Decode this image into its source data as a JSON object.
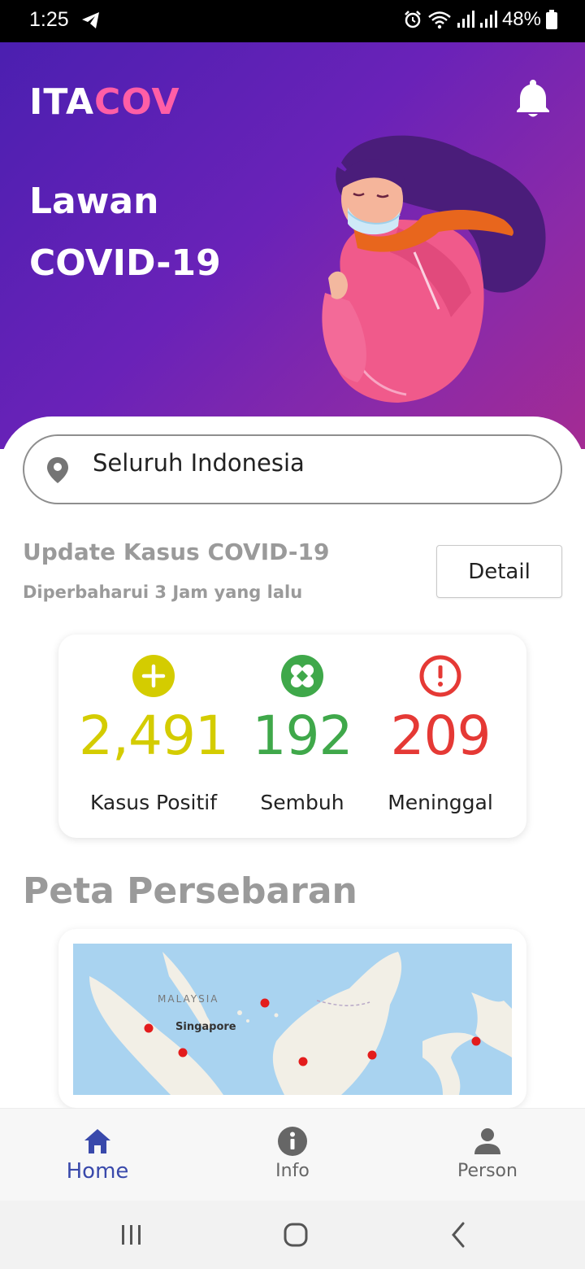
{
  "status_bar": {
    "time": "1:25",
    "battery": "48%"
  },
  "header": {
    "brand_part1": "ITA",
    "brand_part2": "COV",
    "title_line1": "Lawan",
    "title_line2": "COVID-19"
  },
  "location": {
    "label": "Seluruh Indonesia"
  },
  "update": {
    "title": "Update Kasus COVID-19",
    "subtitle": "Diperbaharui 3 Jam yang lalu",
    "detail_label": "Detail"
  },
  "stats": [
    {
      "value": "2,491",
      "label": "Kasus Positif",
      "color": "#d4cc00",
      "icon": "plus-circle-icon"
    },
    {
      "value": "192",
      "label": "Sembuh",
      "color": "#3fa84a",
      "icon": "bandage-icon"
    },
    {
      "value": "209",
      "label": "Meninggal",
      "color": "#e53935",
      "icon": "alert-circle-icon"
    }
  ],
  "map": {
    "heading": "Peta Persebaran",
    "label_malaysia": "MALAYSIA",
    "label_singapore": "Singapore"
  },
  "bottom_nav": [
    {
      "label": "Home",
      "icon": "home-icon",
      "active": true
    },
    {
      "label": "Info",
      "icon": "info-icon",
      "active": false
    },
    {
      "label": "Person",
      "icon": "person-icon",
      "active": false
    }
  ],
  "colors": {
    "accent": "#3949ab",
    "brand_pink": "#ff5ea6",
    "hero_start": "#4b1fb0",
    "hero_end": "#a42b93"
  }
}
